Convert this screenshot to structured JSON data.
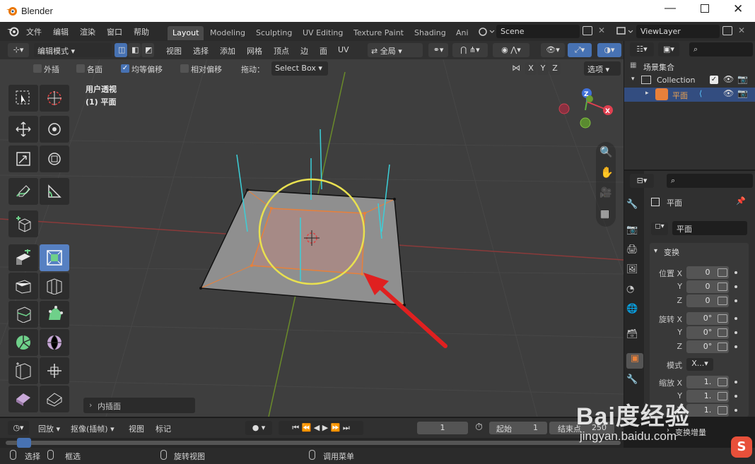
{
  "window": {
    "title": "Blender"
  },
  "menu": {
    "items": [
      "文件",
      "编辑",
      "渲染",
      "窗口",
      "帮助"
    ]
  },
  "workspaces": [
    "Layout",
    "Modeling",
    "Sculpting",
    "UV Editing",
    "Texture Paint",
    "Shading",
    "Ani"
  ],
  "scene": {
    "name": "Scene"
  },
  "view_layer": {
    "name": "ViewLayer"
  },
  "viewport": {
    "mode": "编辑模式",
    "header_menus": [
      "视图",
      "选择",
      "添加",
      "网格",
      "顶点",
      "边",
      "面",
      "UV"
    ],
    "transform_orientation": "全局",
    "tool_options": {
      "outer": "外插",
      "individual": "各面",
      "even_offset": "均等偏移",
      "relative_offset": "相对偏移",
      "drag_label": "拖动：",
      "drag_value": "Select Box",
      "axes": [
        "X",
        "Y",
        "Z"
      ],
      "options": "选项"
    },
    "overlay_view": "用户透视",
    "overlay_object": "(1) 平面",
    "last_op": "内插面",
    "gizmo": {
      "z": "Z",
      "x": "X"
    }
  },
  "outliner": {
    "scene_collection": "场景集合",
    "collection": "Collection",
    "object": "平面"
  },
  "properties": {
    "object_name": "平面",
    "object_field": "平面",
    "transform_panel": "变换",
    "location_label": "位置 X",
    "location": {
      "y_label": "Y",
      "z_label": "Z",
      "x": "0",
      "y": "0",
      "z": "0"
    },
    "rotation_label": "旋转 X",
    "rotation": {
      "y_label": "Y",
      "z_label": "Z",
      "x": "0°",
      "y": "0°",
      "z": "0°"
    },
    "mode_label": "模式",
    "mode_value": "X...",
    "scale_label": "缩放 X",
    "scale": {
      "y_label": "Y",
      "z_label": "Z",
      "x": "1.",
      "y": "1.",
      "z": "1."
    },
    "delta_panel": "变换增量"
  },
  "timeline": {
    "playback": "回放",
    "keying": "抠像(插帧)",
    "view": "视图",
    "marker": "标记",
    "current_frame": "1",
    "start_label": "起始",
    "start": "1",
    "end_label": "结束点",
    "end": "250"
  },
  "statusbar": {
    "select": "选择",
    "box": "框选",
    "rotate": "旋转视图",
    "menu": "调用菜单"
  },
  "watermark": {
    "brand": "Bai度经验",
    "url": "jingyan.baidu.com"
  },
  "colors": {
    "accent": "#4772b3",
    "selection_circle": "#e8e050",
    "face_select": "#e8803a",
    "arrow": "#e02020",
    "normals": "#3ccfd8"
  }
}
